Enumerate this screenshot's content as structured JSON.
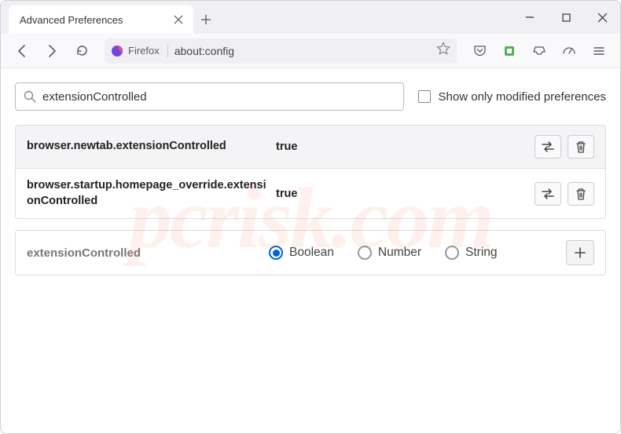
{
  "window": {
    "tab_title": "Advanced Preferences"
  },
  "urlbar": {
    "identity_label": "Firefox",
    "url": "about:config"
  },
  "search": {
    "value": "extensionControlled",
    "checkbox_label": "Show only modified preferences"
  },
  "prefs": [
    {
      "name": "browser.newtab.extensionControlled",
      "value": "true"
    },
    {
      "name": "browser.startup.homepage_override.extensionControlled",
      "value": "true"
    }
  ],
  "new_pref": {
    "name": "extensionControlled",
    "types": [
      "Boolean",
      "Number",
      "String"
    ],
    "selected": "Boolean"
  },
  "watermark": "pcrisk.com"
}
